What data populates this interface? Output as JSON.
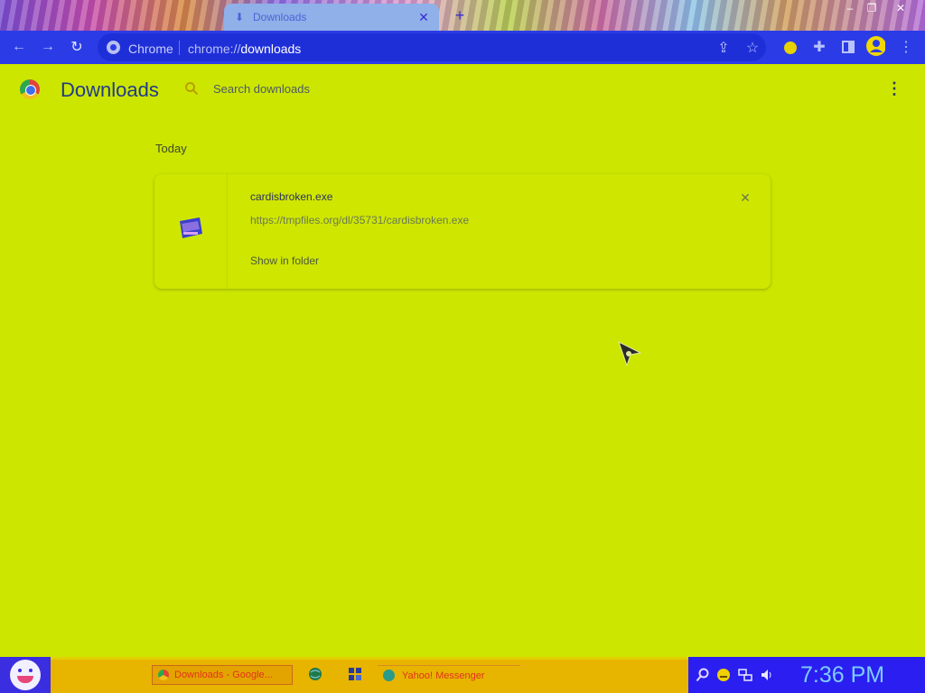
{
  "browser": {
    "tab_title": "Downloads",
    "omnibox_chip": "Chrome",
    "url_scheme": "chrome://",
    "url_host": "downloads"
  },
  "page": {
    "title": "Downloads",
    "search_placeholder": "Search downloads"
  },
  "downloads": {
    "section_label": "Today",
    "items": [
      {
        "file_name": "cardisbroken.exe",
        "url": "https://tmpfiles.org/dl/35731/cardisbroken.exe",
        "action_label": "Show in folder"
      }
    ]
  },
  "taskbar": {
    "chrome_task_label": "Downloads - Google...",
    "yahoo_task_label": "Yahoo! Messenger",
    "clock": "7:36 PM"
  },
  "colors": {
    "page_background": "#cde600",
    "toolbar": "#2b3ce6",
    "taskbar": "#e7b400",
    "tray": "#2a1ff0"
  }
}
